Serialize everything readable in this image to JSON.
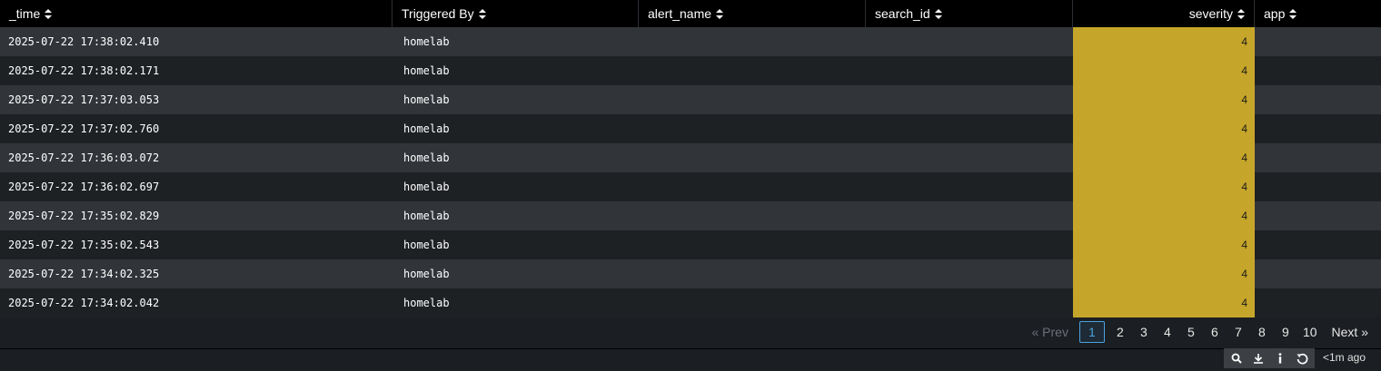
{
  "table": {
    "columns": [
      {
        "label": "_time"
      },
      {
        "label": "Triggered By"
      },
      {
        "label": "alert_name"
      },
      {
        "label": "search_id"
      },
      {
        "label": "severity"
      },
      {
        "label": "app"
      }
    ],
    "rows": [
      {
        "time": "2025-07-22 17:38:02.410",
        "triggered_by": "homelab",
        "alert_name": "",
        "search_id": "",
        "severity": "4",
        "app": ""
      },
      {
        "time": "2025-07-22 17:38:02.171",
        "triggered_by": "homelab",
        "alert_name": "",
        "search_id": "",
        "severity": "4",
        "app": ""
      },
      {
        "time": "2025-07-22 17:37:03.053",
        "triggered_by": "homelab",
        "alert_name": "",
        "search_id": "",
        "severity": "4",
        "app": ""
      },
      {
        "time": "2025-07-22 17:37:02.760",
        "triggered_by": "homelab",
        "alert_name": "",
        "search_id": "",
        "severity": "4",
        "app": ""
      },
      {
        "time": "2025-07-22 17:36:03.072",
        "triggered_by": "homelab",
        "alert_name": "",
        "search_id": "",
        "severity": "4",
        "app": ""
      },
      {
        "time": "2025-07-22 17:36:02.697",
        "triggered_by": "homelab",
        "alert_name": "",
        "search_id": "",
        "severity": "4",
        "app": ""
      },
      {
        "time": "2025-07-22 17:35:02.829",
        "triggered_by": "homelab",
        "alert_name": "",
        "search_id": "",
        "severity": "4",
        "app": ""
      },
      {
        "time": "2025-07-22 17:35:02.543",
        "triggered_by": "homelab",
        "alert_name": "",
        "search_id": "",
        "severity": "4",
        "app": ""
      },
      {
        "time": "2025-07-22 17:34:02.325",
        "triggered_by": "homelab",
        "alert_name": "",
        "search_id": "",
        "severity": "4",
        "app": ""
      },
      {
        "time": "2025-07-22 17:34:02.042",
        "triggered_by": "homelab",
        "alert_name": "",
        "search_id": "",
        "severity": "4",
        "app": ""
      }
    ],
    "severity_color": "#c6a62a"
  },
  "pagination": {
    "prev_label": "« Prev",
    "pages": [
      "1",
      "2",
      "3",
      "4",
      "5",
      "6",
      "7",
      "8",
      "9",
      "10"
    ],
    "current_page": "1",
    "next_label": "Next »"
  },
  "toolbar": {
    "icons": [
      "search-icon",
      "download-icon",
      "info-icon",
      "refresh-icon"
    ],
    "updated_label": "<1m ago"
  },
  "colors": {
    "header_bg": "#000000",
    "row_odd": "#31353a",
    "row_even": "#1e2124",
    "accent": "#4aa3df"
  }
}
